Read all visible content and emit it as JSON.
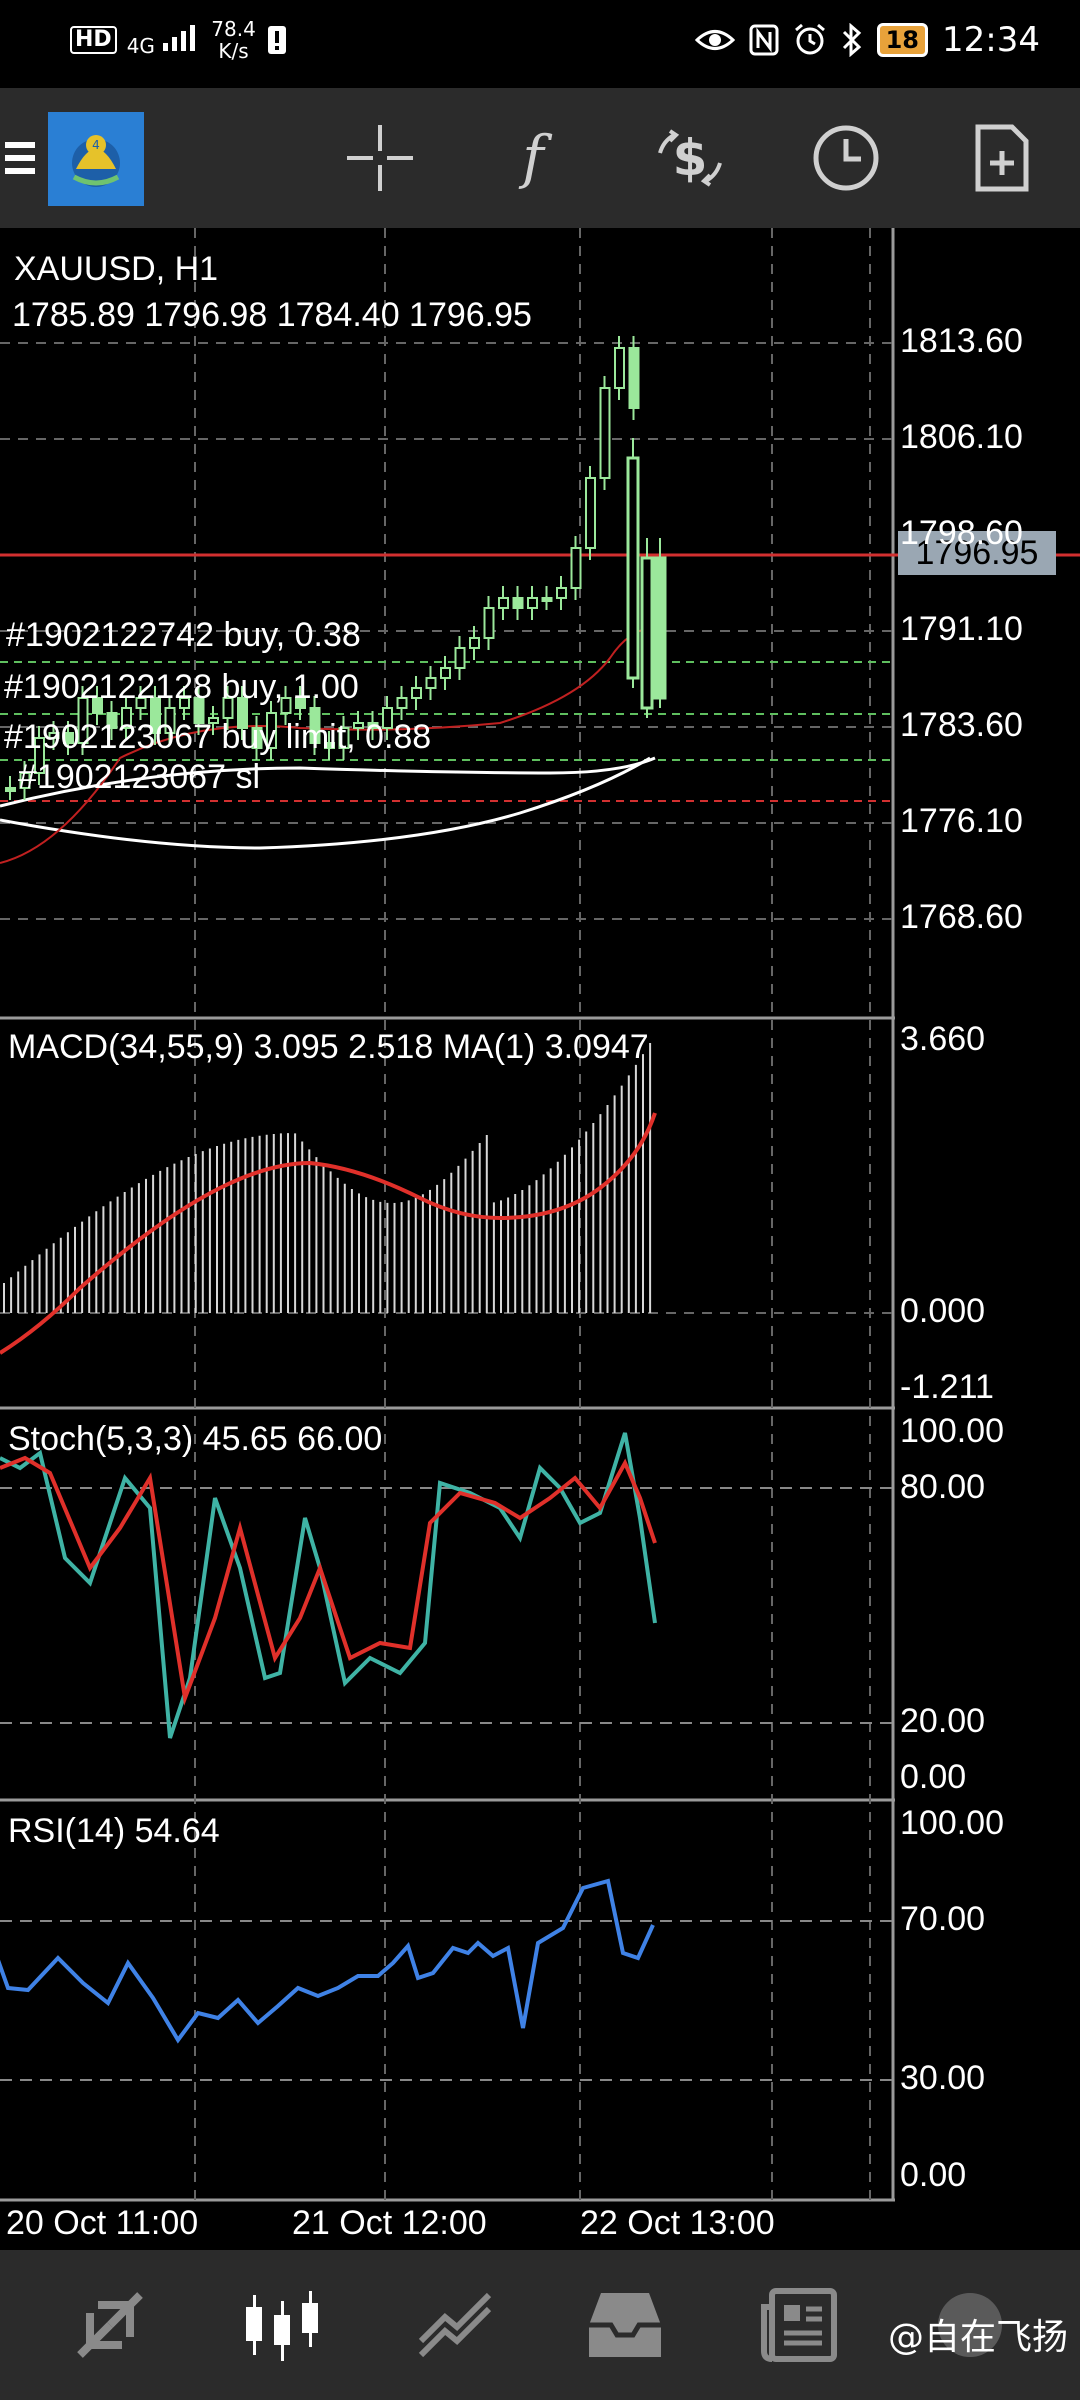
{
  "status_bar": {
    "hd": "HD",
    "network": "4G",
    "speed_value": "78.4",
    "speed_unit": "K/s",
    "battery": "18",
    "time": "12:34"
  },
  "toolbar": {
    "icons": [
      "menu-icon",
      "mt4-logo",
      "crosshair-icon",
      "indicator-f-icon",
      "trade-dollar-icon",
      "clock-icon",
      "new-document-icon"
    ]
  },
  "chart": {
    "symbol_label": "XAUUSD, H1",
    "ohlc_label": "1785.89 1796.98 1784.40 1796.95",
    "current_price": "1796.95",
    "price_axis": [
      "1813.60",
      "1806.10",
      "1798.60",
      "1791.10",
      "1783.60",
      "1776.10",
      "1768.60"
    ],
    "orders": [
      "#1902122742 buy, 0.38",
      "#1902122128 buy, 1.00",
      "#1902123067 buy limit, 0.88",
      "#1902123067 sl"
    ]
  },
  "macd": {
    "label": "MACD(34,55,9) 3.095 2.518 MA(1) 3.0947",
    "axis": [
      "3.660",
      "0.000",
      "-1.211"
    ]
  },
  "stoch": {
    "label": "Stoch(5,3,3) 45.65 66.00",
    "axis": [
      "100.00",
      "80.00",
      "20.00",
      "0.00"
    ]
  },
  "rsi": {
    "label": "RSI(14) 54.64",
    "axis": [
      "100.00",
      "70.00",
      "30.00",
      "0.00"
    ]
  },
  "time_axis": [
    "20 Oct 11:00",
    "21 Oct 12:00",
    "22 Oct 13:00"
  ],
  "bottom_nav": {
    "items": [
      "quotes-icon",
      "chart-icon",
      "trade-icon",
      "history-icon",
      "news-icon"
    ],
    "watermark": "@自在飞扬"
  },
  "colors": {
    "background": "#000000",
    "toolbar": "#2b2b2b",
    "bull_candle": "#9be89b",
    "macd_signal": "#e0302a",
    "stoch_main": "#3fb3a5",
    "stoch_signal": "#e0302a",
    "rsi": "#3f82e6"
  }
}
